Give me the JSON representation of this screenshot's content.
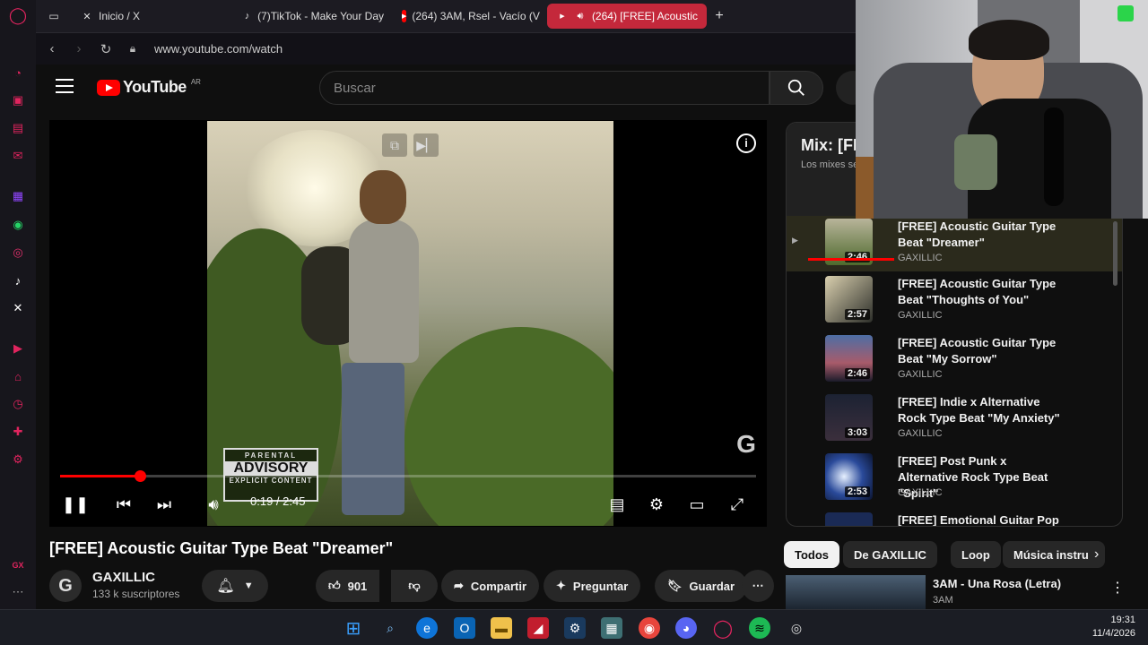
{
  "browser": {
    "tabs": [
      {
        "label": "Inicio / X",
        "icon": "x-logo-icon",
        "active": false
      },
      {
        "label": "(7)TikTok - Make Your Day",
        "icon": "tiktok-icon",
        "active": false
      },
      {
        "label": "(264) 3AM, Rsel - Vacío (V",
        "icon": "youtube-icon",
        "active": false
      },
      {
        "label": "(264) [FREE] Acoustic",
        "icon": "youtube-icon",
        "active": true
      }
    ],
    "url": "www.youtube.com/watch"
  },
  "youtube": {
    "logo_text": "YouTube",
    "country": "AR",
    "search_placeholder": "Buscar",
    "player": {
      "current_time": "0:19",
      "duration": "2:45",
      "time_display": "0:19 / 2:45",
      "progress": 0.115,
      "advisory": {
        "line1": "PARENTAL",
        "line2": "ADVISORY",
        "line3": "EXPLICIT CONTENT"
      }
    },
    "video_title": "[FREE] Acoustic Guitar Type Beat \"Dreamer\"",
    "channel": {
      "name": "GAXILLIC",
      "subscribers": "133 k suscriptores"
    },
    "actions": {
      "likes": "901",
      "share": "Compartir",
      "ask": "Preguntar",
      "save": "Guardar"
    },
    "playlist": {
      "title": "Mix: [FR",
      "subtitle": "Los mixes se",
      "items": [
        {
          "title": "[FREE] Acoustic Guitar Type Beat \"Dreamer\"",
          "channel": "GAXILLIC",
          "duration": "2:46",
          "current": true
        },
        {
          "title": "[FREE] Acoustic Guitar Type Beat \"Thoughts of You\"",
          "channel": "GAXILLIC",
          "duration": "2:57",
          "current": false
        },
        {
          "title": "[FREE] Acoustic Guitar Type Beat \"My Sorrow\"",
          "channel": "GAXILLIC",
          "duration": "2:46",
          "current": false
        },
        {
          "title": "[FREE] Indie x Alternative Rock Type Beat \"My Anxiety\"",
          "channel": "GAXILLIC",
          "duration": "3:03",
          "current": false
        },
        {
          "title": "[FREE] Post Punk x Alternative Rock Type Beat \"Spirit\"",
          "channel": "GAXILLIC",
          "duration": "2:53",
          "current": false
        },
        {
          "title": "[FREE] Emotional Guitar Pop",
          "channel": "",
          "duration": "",
          "current": false
        }
      ]
    },
    "chips": [
      "Todos",
      "De GAXILLIC",
      "Loop",
      "Música instru"
    ],
    "recommendation": {
      "title": "3AM - Una Rosa (Letra)",
      "channel": "3AM"
    }
  },
  "taskbar": {
    "time": "19:31",
    "date": "11/4/2026"
  },
  "colors": {
    "accent_red": "#ff0000",
    "opera_red": "#c4283b",
    "background": "#0f0f0f"
  }
}
